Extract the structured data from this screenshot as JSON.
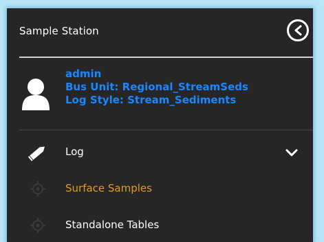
{
  "header": {
    "title": "Sample Station"
  },
  "user": {
    "username": "admin",
    "bus_unit": "Bus Unit: Regional_StreamSeds",
    "log_style": "Log Style: Stream_Sediments"
  },
  "menu": {
    "items": [
      {
        "label": "Log",
        "icon": "pencil-icon"
      },
      {
        "label": "Surface Samples",
        "icon": "crosshair-icon",
        "color": "#e29a23"
      },
      {
        "label": "Standalone Tables",
        "icon": "crosshair-icon"
      }
    ]
  },
  "colors": {
    "background": "#262626",
    "accent_blue": "#1a86ff",
    "accent_orange": "#e29a23",
    "frame": "#b9e6f7"
  }
}
